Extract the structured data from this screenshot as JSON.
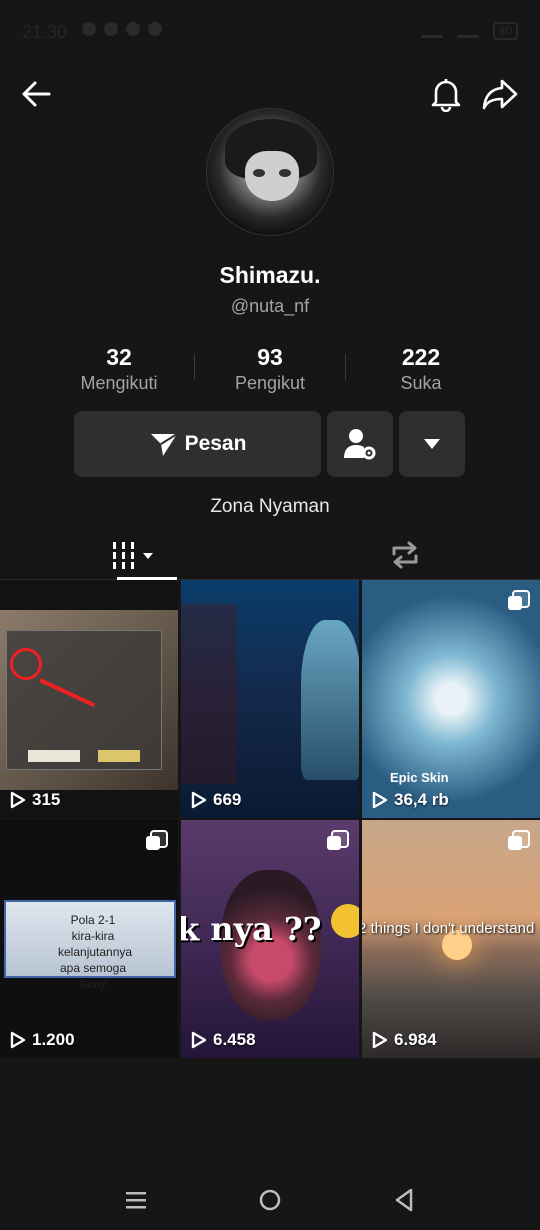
{
  "status_bar": {
    "time": "21.30",
    "battery": "80"
  },
  "profile": {
    "display_name": "Shimazu.",
    "username": "@nuta_nf",
    "bio": "Zona Nyaman"
  },
  "stats": [
    {
      "value": "32",
      "label": "Mengikuti"
    },
    {
      "value": "93",
      "label": "Pengikut"
    },
    {
      "value": "222",
      "label": "Suka"
    }
  ],
  "actions": {
    "message_label": "Pesan"
  },
  "videos": [
    {
      "views": "315",
      "caption": "",
      "multi": false
    },
    {
      "views": "669",
      "caption": "",
      "multi": false
    },
    {
      "views": "36,4 rb",
      "caption": "Epic Skin",
      "multi": true
    },
    {
      "views": "1.200",
      "caption": "Pola 2-1 kira-kira kelanjutannya apa semoga famy",
      "multi": true
    },
    {
      "views": "6.458",
      "caption": "k nya ??",
      "multi": true
    },
    {
      "views": "6.984",
      "caption": "2 things I don't understand",
      "multi": true
    }
  ],
  "colors": {
    "background": "#161616",
    "button": "#2f2f2f",
    "secondary_text": "#a3a3a3"
  },
  "icons": [
    "back-arrow-icon",
    "bell-icon",
    "share-icon",
    "send-icon",
    "person-settings-icon",
    "caret-down-icon",
    "grid-icon",
    "repost-icon",
    "play-icon",
    "recents-icon",
    "home-icon",
    "back-triangle-icon"
  ]
}
